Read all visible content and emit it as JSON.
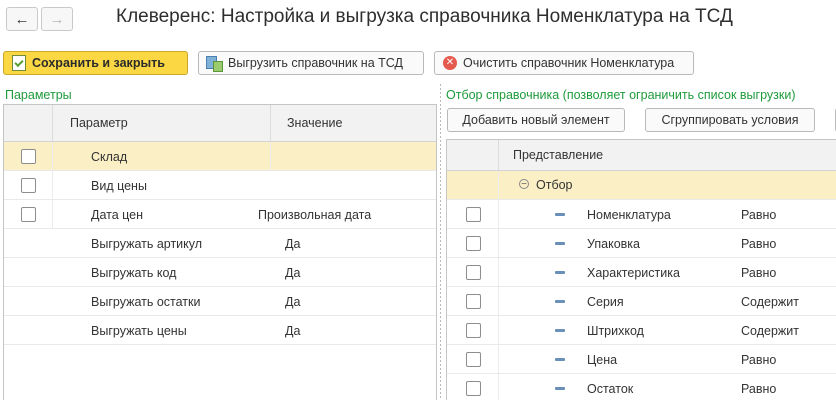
{
  "window": {
    "title": "Клеверенс: Настройка и выгрузка справочника Номенклатура на ТСД",
    "back_icon": "←",
    "forward_icon": "→"
  },
  "toolbar": {
    "save_close_label": "Сохранить и закрыть",
    "export_label": "Выгрузить справочник на ТСД",
    "clear_label": "Очистить справочник Номенклатура",
    "clear_icon_glyph": "✕"
  },
  "params": {
    "section_label": "Параметры",
    "col_param": "Параметр",
    "col_value": "Значение",
    "rows": [
      {
        "name": "Склад",
        "value": ""
      },
      {
        "name": "Вид цены",
        "value": ""
      },
      {
        "name": "Дата цен",
        "value": "Произвольная дата"
      },
      {
        "name": "Выгружать артикул",
        "value": "Да"
      },
      {
        "name": "Выгружать код",
        "value": "Да"
      },
      {
        "name": "Выгружать остатки",
        "value": "Да"
      },
      {
        "name": "Выгружать цены",
        "value": "Да"
      }
    ]
  },
  "filter": {
    "section_label": "Отбор справочника (позволяет ограничить список выгрузки)",
    "add_button": "Добавить новый элемент",
    "group_button": "Сгруппировать условия",
    "col_repr": "Представление",
    "group_label": "Отбор",
    "group_icon_glyph": "−",
    "rows": [
      {
        "field": "Номенклатура",
        "condition": "Равно"
      },
      {
        "field": "Упаковка",
        "condition": "Равно"
      },
      {
        "field": "Характеристика",
        "condition": "Равно"
      },
      {
        "field": "Серия",
        "condition": "Содержит"
      },
      {
        "field": "Штрихкод",
        "condition": "Содержит"
      },
      {
        "field": "Цена",
        "condition": "Равно"
      },
      {
        "field": "Остаток",
        "condition": "Равно"
      }
    ]
  },
  "colors": {
    "accent_yellow": "#fbd843",
    "section_green": "#1e9b3c",
    "selection": "#fbf0c5"
  }
}
